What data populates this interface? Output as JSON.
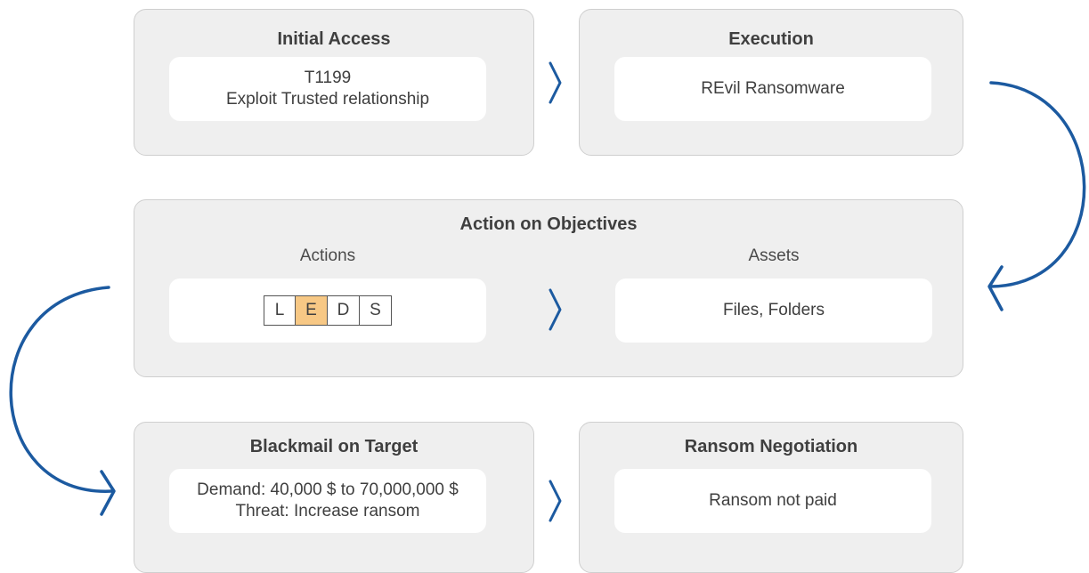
{
  "colors": {
    "arrow": "#1c5aa0",
    "panel": "#efefef",
    "card": "#ffffff",
    "leds_highlight": "#f7c885"
  },
  "initial_access": {
    "title": "Initial Access",
    "line1": "T1199",
    "line2": "Exploit Trusted relationship"
  },
  "execution": {
    "title": "Execution",
    "text": "REvil Ransomware"
  },
  "action_on_objectives": {
    "title": "Action on Objectives",
    "actions_label": "Actions",
    "assets_label": "Assets",
    "leds": [
      {
        "letter": "L",
        "highlighted": false
      },
      {
        "letter": "E",
        "highlighted": true
      },
      {
        "letter": "D",
        "highlighted": false
      },
      {
        "letter": "S",
        "highlighted": false
      }
    ],
    "assets_text": "Files, Folders"
  },
  "blackmail": {
    "title": "Blackmail on Target",
    "line1": "Demand: 40,000 $ to 70,000,000 $",
    "line2": "Threat: Increase ransom"
  },
  "ransom_negotiation": {
    "title": "Ransom Negotiation",
    "text": "Ransom not paid"
  },
  "icons": {
    "chevron": "chevron-right-icon",
    "flow_arrow": "curved-arrow-icon"
  }
}
